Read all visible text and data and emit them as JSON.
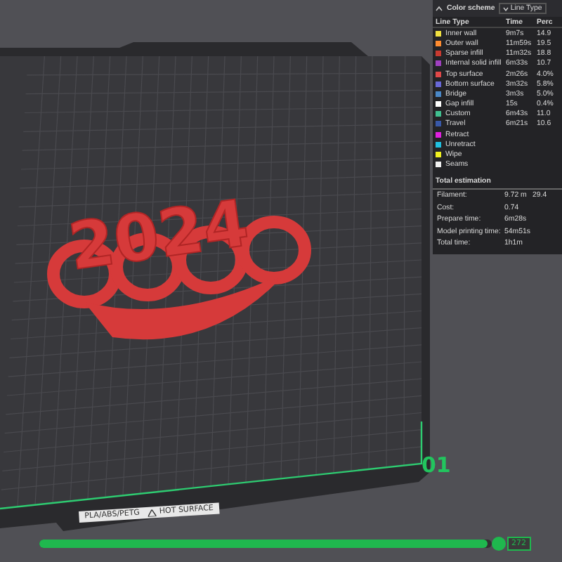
{
  "legend": {
    "title": "Color scheme",
    "scheme_dropdown": "Line Type",
    "columns": [
      "Line Type",
      "Time",
      "Perc"
    ],
    "rows": [
      {
        "name": "Inner wall",
        "time": "9m7s",
        "percent": "14.9",
        "color": "#f0e040"
      },
      {
        "name": "Outer wall",
        "time": "11m59s",
        "percent": "19.5",
        "color": "#ff8c30"
      },
      {
        "name": "Sparse infill",
        "time": "11m32s",
        "percent": "18.8",
        "color": "#c83a30"
      },
      {
        "name": "Internal solid infill",
        "time": "6m33s",
        "percent": "10.7",
        "color": "#a040c0"
      },
      {
        "name": "Top surface",
        "time": "2m26s",
        "percent": "4.0%",
        "color": "#e04848"
      },
      {
        "name": "Bottom surface",
        "time": "3m32s",
        "percent": "5.8%",
        "color": "#6868d8"
      },
      {
        "name": "Bridge",
        "time": "3m3s",
        "percent": "5.0%",
        "color": "#4a88c8"
      },
      {
        "name": "Gap infill",
        "time": "15s",
        "percent": "0.4%",
        "color": "#ffffff"
      },
      {
        "name": "Custom",
        "time": "6m43s",
        "percent": "11.0",
        "color": "#40c090"
      },
      {
        "name": "Travel",
        "time": "6m21s",
        "percent": "10.6",
        "color": "#3858a8"
      },
      {
        "name": "Retract",
        "color": "#e020e0"
      },
      {
        "name": "Unretract",
        "color": "#20c0e0"
      },
      {
        "name": "Wipe",
        "color": "#f0f020"
      },
      {
        "name": "Seams",
        "color": "#f0f0f0"
      }
    ],
    "estimation_title": "Total estimation",
    "estimation": [
      {
        "label": "Filament:",
        "value": "9.72 m",
        "extra": "29.4"
      },
      {
        "label": "Cost:",
        "value": "0.74"
      },
      {
        "label": "Prepare time:",
        "value": "6m28s"
      },
      {
        "label": "Model printing time:",
        "value": "54m51s"
      },
      {
        "label": "Total time:",
        "value": "1h1m"
      }
    ]
  },
  "model_text": "2024",
  "plate": {
    "number": "01",
    "material_label": "PLA/ABS/PETG",
    "warning": "HOT SURFACE"
  },
  "layer_slider": {
    "level": 0.99,
    "value": "272"
  }
}
